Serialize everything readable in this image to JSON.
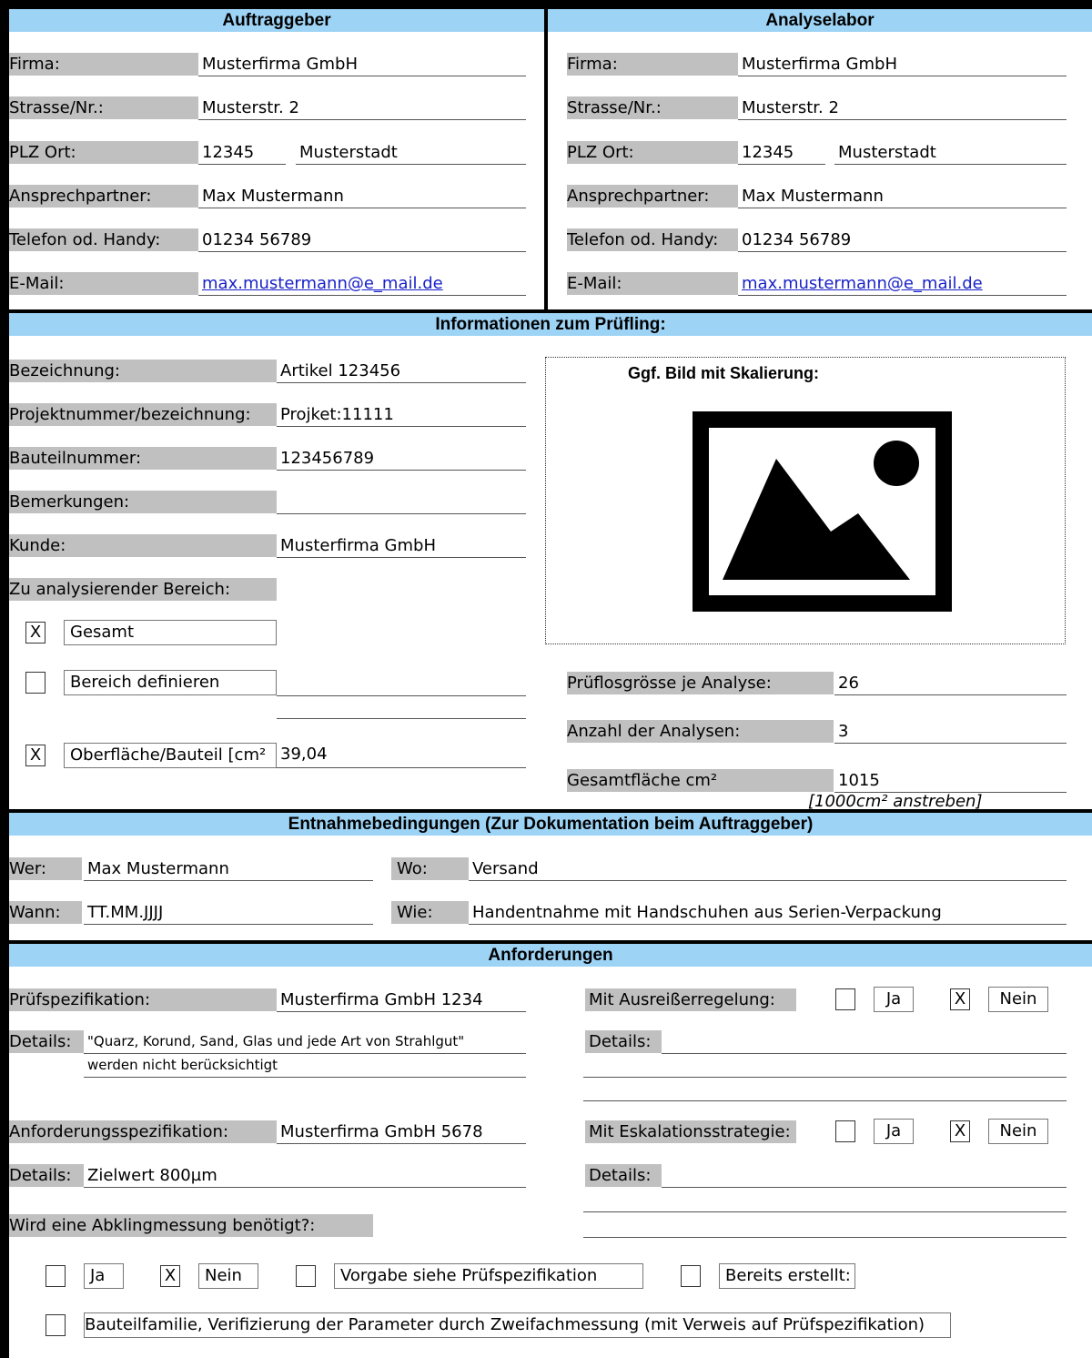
{
  "auftraggeber": {
    "header": "Auftraggeber",
    "firma_label": "Firma:",
    "firma": "Musterfirma GmbH",
    "strasse_label": "Strasse/Nr.:",
    "strasse": "Musterstr. 2",
    "plz_label": "PLZ Ort:",
    "plz": "12345",
    "ort": "Musterstadt",
    "ansprech_label": "Ansprechpartner:",
    "ansprech": "Max Mustermann",
    "telefon_label": "Telefon od. Handy:",
    "telefon": "01234 56789",
    "email_label": "E-Mail:",
    "email": "max.mustermann@e_mail.de"
  },
  "analyselabor": {
    "header": "Analyselabor",
    "firma_label": "Firma:",
    "firma": "Musterfirma GmbH",
    "strasse_label": "Strasse/Nr.:",
    "strasse": "Musterstr. 2",
    "plz_label": "PLZ Ort:",
    "plz": "12345",
    "ort": "Musterstadt",
    "ansprech_label": "Ansprechpartner:",
    "ansprech": "Max Mustermann",
    "telefon_label": "Telefon od. Handy:",
    "telefon": "01234 56789",
    "email_label": "E-Mail:",
    "email": "max.mustermann@e_mail.de"
  },
  "pruefling": {
    "header": "Informationen zum Prüfling:",
    "bezeichnung_label": "Bezeichnung:",
    "bezeichnung": "Artikel 123456",
    "projekt_label": "Projektnummer/bezeichnung:",
    "projekt": "Projket:11111",
    "bauteilnr_label": "Bauteilnummer:",
    "bauteilnr": "123456789",
    "bemerkungen_label": "Bemerkungen:",
    "bemerkungen": "",
    "kunde_label": "Kunde:",
    "kunde": "Musterfirma GmbH",
    "bereich_label": "Zu analysierender Bereich:",
    "gesamt_check": "X",
    "gesamt_label": "Gesamt",
    "definieren_check": "",
    "definieren_label": "Bereich definieren",
    "oberflaeche_check": "X",
    "oberflaeche_label": "Oberfläche/Bauteil [cm²",
    "oberflaeche": "39,04",
    "bild_label": "Ggf. Bild mit Skalierung:",
    "bild_icon": "image-placeholder-icon",
    "losgroesse_label": "Prüflosgrösse je Analyse:",
    "losgroesse": "26",
    "anzahl_label": "Anzahl der  Analysen:",
    "anzahl": "3",
    "gesamtflaeche_label": "Gesamtfläche cm²",
    "gesamtflaeche": "1015",
    "hinweis": "[1000cm² anstreben]"
  },
  "entnahme": {
    "header": "Entnahmebedingungen (Zur Dokumentation beim Auftraggeber)",
    "wer_label": "Wer:",
    "wer": "Max Mustermann",
    "wo_label": "Wo:",
    "wo": "Versand",
    "wann_label": "Wann:",
    "wann": "TT.MM.JJJJ",
    "wie_label": "Wie:",
    "wie": "Handentnahme mit Handschuhen aus Serien-Verpackung"
  },
  "anforderungen": {
    "header": "Anforderungen",
    "pruefspez_label": "Prüfspezifikation:",
    "pruefspez": "Musterfirma GmbH  1234",
    "details_label": "Details:",
    "details1_line1": "\"Quarz, Korund, Sand, Glas und jede Art von Strahlgut\"",
    "details1_line2": "werden nicht berücksichtigt",
    "ausreisser_label": "Mit Ausreißerregelung:",
    "ausreisser_ja_check": "",
    "ja_label": "Ja",
    "ausreisser_nein_check": "X",
    "nein_label": "Nein",
    "anfspez_label": "Anforderungsspezifikation:",
    "anfspez": "Musterfirma GmbH 5678",
    "details2": "Zielwert 800µm",
    "eskalation_label": "Mit Eskalationsstrategie:",
    "eskalation_ja_check": "",
    "eskalation_nein_check": "X",
    "abkling_label": "Wird eine Abklingmessung benötigt?:",
    "abkling_ja_check": "",
    "abkling_nein_check": "X",
    "vorgabe_check": "",
    "vorgabe_label": "Vorgabe siehe Prüfspezifikation",
    "bereits_check": "",
    "bereits_label": "Bereits erstellt:",
    "familie_check": "",
    "familie_label": "Bauteilfamilie, Verifizierung der Parameter durch Zweifachmessung (mit Verweis auf Prüfspezifikation)"
  }
}
